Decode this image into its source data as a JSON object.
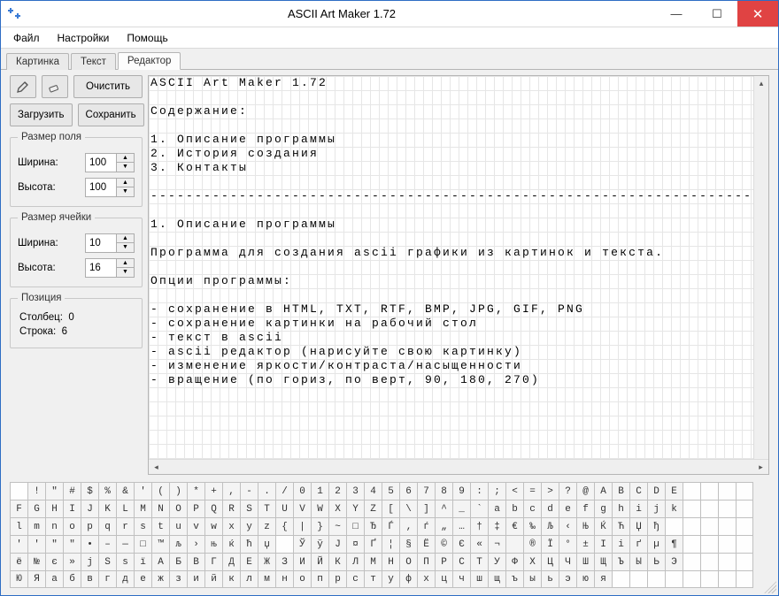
{
  "window": {
    "title": "ASCII Art Maker 1.72"
  },
  "menus": {
    "file": "Файл",
    "settings": "Настройки",
    "help": "Помощь"
  },
  "tabs": {
    "picture": "Картинка",
    "text": "Текст",
    "editor": "Редактор"
  },
  "toolbar": {
    "clear": "Очистить",
    "load": "Загрузить",
    "save": "Сохранить"
  },
  "fieldSize": {
    "legend": "Размер поля",
    "widthLabel": "Ширина:",
    "heightLabel": "Высота:",
    "width": "100",
    "height": "100"
  },
  "cellSize": {
    "legend": "Размер ячейки",
    "widthLabel": "Ширина:",
    "heightLabel": "Высота:",
    "width": "10",
    "height": "16"
  },
  "position": {
    "legend": "Позиция",
    "colLabel": "Столбец:",
    "rowLabel": "Строка:",
    "col": "0",
    "row": "6"
  },
  "editorText": "ASCII Art Maker 1.72\n\nСодержание:\n\n1. Описание программы\n2. История создания\n3. Контакты\n\n--------------------------------------------------------------------\n\n1. Описание программы\n\nПрограмма для создания ascii графики из картинок и текста.\n\nОпции программы:\n\n- сохранение в HTML, TXT, RTF, BMP, JPG, GIF, PNG\n- сохранение картинки на рабочий стол\n- текст в ascii\n- ascii редактор (нарисуйте свою картинку)\n- изменение яркости/контраста/насыщенности\n- вращение (по гориз, по верт, 90, 180, 270)",
  "charRows": [
    " !\"#$%&'()*+,-./0123456789:;<=>?@ABCDE",
    "FGHIJKLMNOPQRSTUVWXYZ[\\]^_`abcdefghijk",
    "lmnopqrstuvwxyz{|}~□ЂЃ‚ѓ„…†‡€‰Љ‹ЊЌЋЏђ",
    "''\"\"•–—□™љ›њќћџ ЎўЈ¤Ґ¦§Ё©Є«¬­®Ї°±Ііґµ¶",
    "ё№є»јЅѕїАБВГДЕЖЗИЙКЛМНОПРСТУФХЦЧШЩЪЫЬЭ",
    "ЮЯабвгдежзийклмнопрстуфхцчшщъыьэюя    "
  ]
}
